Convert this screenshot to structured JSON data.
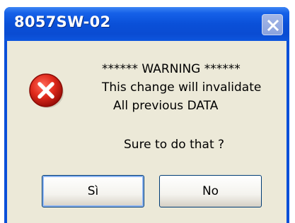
{
  "window": {
    "title": "8057SW-02"
  },
  "message": {
    "line1": "****** WARNING ******",
    "line2": "This change will invalidate",
    "line3": "All previous DATA",
    "question": "Sure to do that  ?"
  },
  "buttons": {
    "yes_label": "Sì",
    "no_label": "No"
  },
  "icons": {
    "status": "error-icon",
    "close": "close-icon"
  },
  "colors": {
    "titlebar": "#0a4fd8",
    "dialog_background": "#ece9d8",
    "error_red": "#d81e1e"
  }
}
